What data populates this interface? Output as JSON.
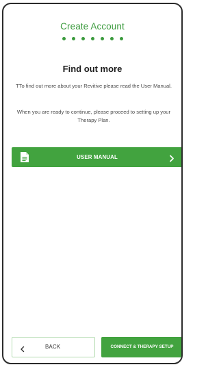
{
  "header": {
    "title": "Create Account",
    "progress_steps": 7
  },
  "content": {
    "heading": "Find out more",
    "paragraph1": "TTo find out more about your Revitive please read the User Manual.",
    "paragraph2": "When you are ready to continue, please proceed to setting up your Therapy Plan."
  },
  "user_manual_button": {
    "label": "USER MANUAL",
    "icon": "document-icon",
    "trailing_icon": "chevron-right-icon"
  },
  "footer": {
    "back_label": "BACK",
    "back_icon": "chevron-left-icon",
    "next_label": "CONNECT & THERAPY SETUP"
  },
  "colors": {
    "accent": "#42a33f",
    "title": "#3a9a3c",
    "back_border": "#b4dcb0"
  }
}
